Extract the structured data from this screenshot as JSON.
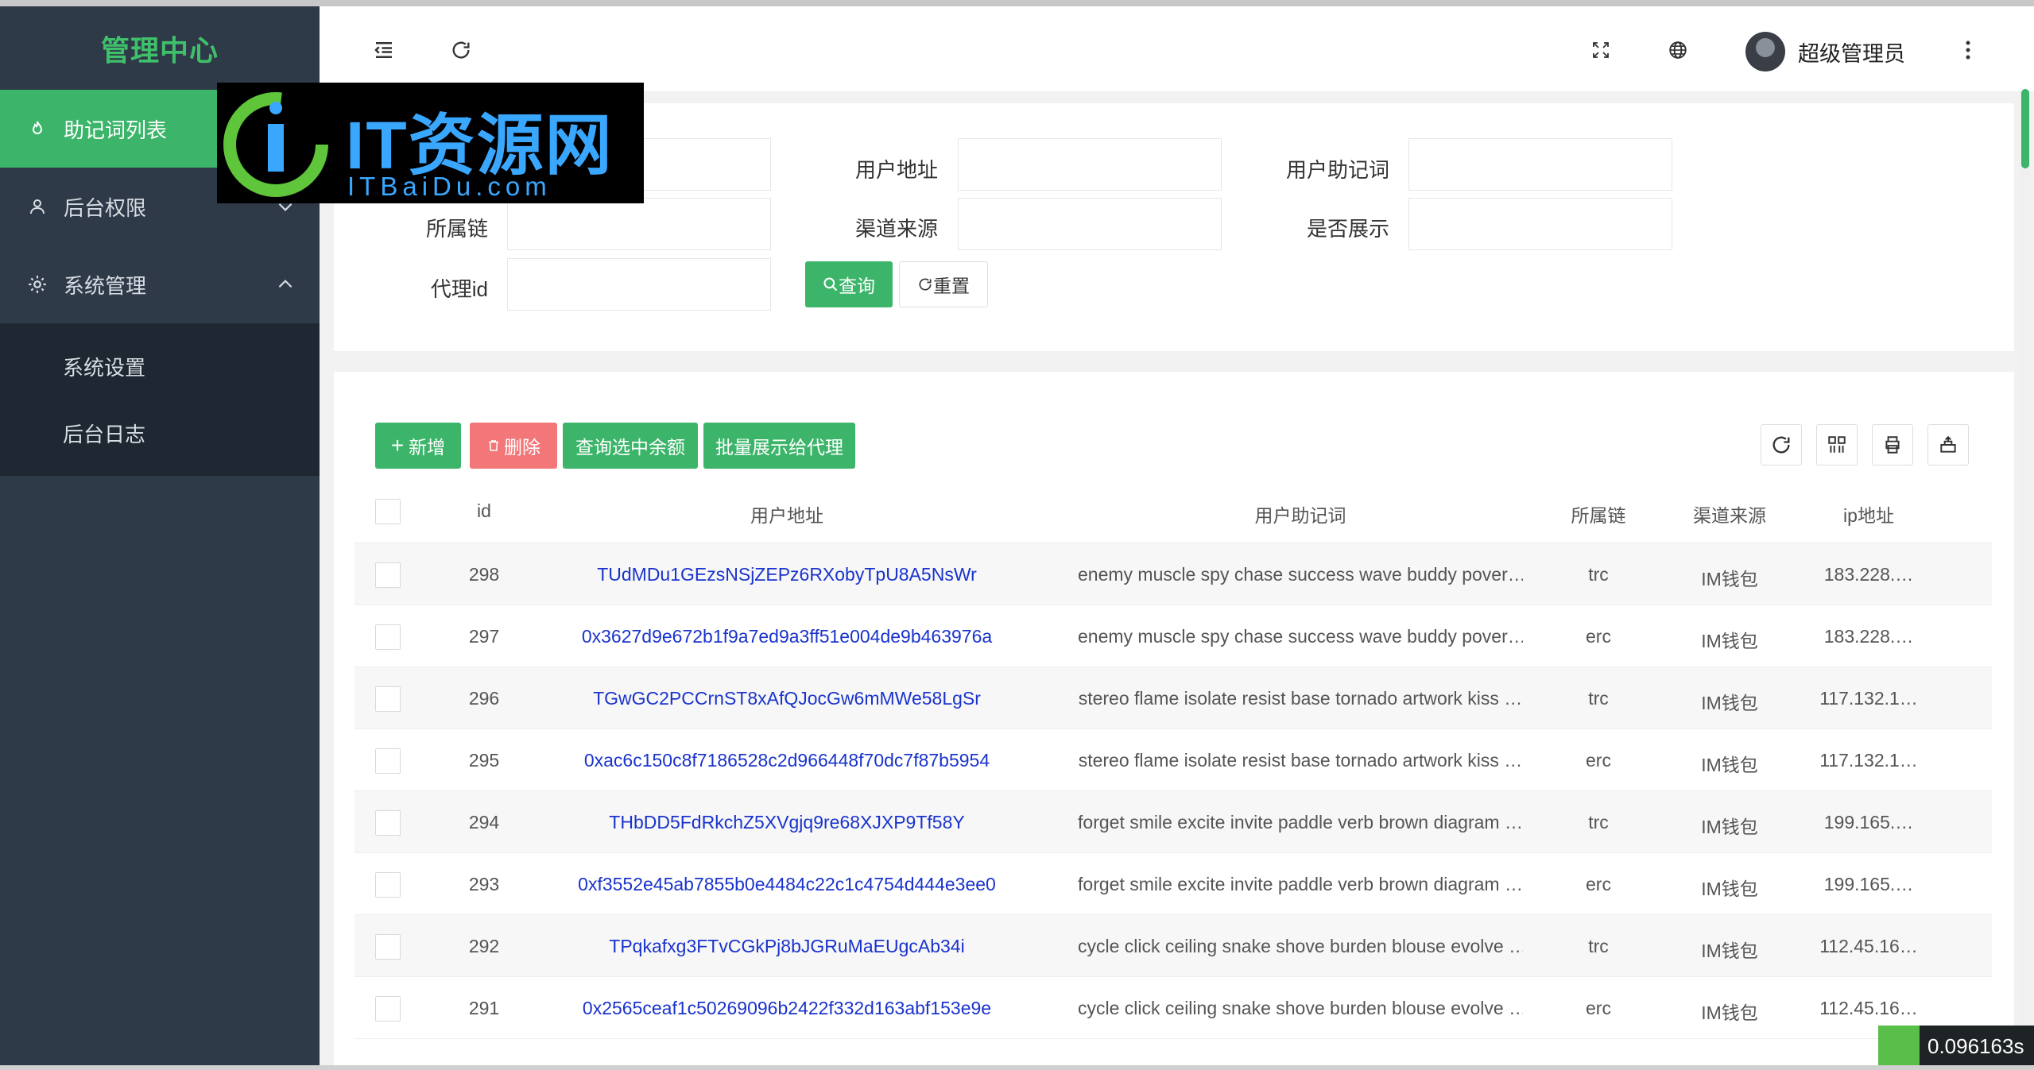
{
  "sidebar": {
    "brand": "管理中心",
    "items": [
      {
        "label": "助记词列表",
        "active": true
      },
      {
        "label": "后台权限"
      },
      {
        "label": "系统管理",
        "expanded": true
      }
    ],
    "subitems": [
      "系统设置",
      "后台日志"
    ]
  },
  "watermark": {
    "big": "IT资源网",
    "small": "ITBaiDu.com"
  },
  "header": {
    "username": "超级管理员"
  },
  "search": {
    "fields": {
      "user_address": "用户地址",
      "user_mnemonic": "用户助记词",
      "chain": "所属链",
      "channel": "渠道来源",
      "display": "是否展示",
      "agent_id": "代理id"
    },
    "query_button": "查询",
    "reset_button": "重置"
  },
  "toolbar": {
    "add": "新增",
    "delete": "删除",
    "query_balance": "查询选中余额",
    "batch_show": "批量展示给代理"
  },
  "table": {
    "columns": [
      "id",
      "用户地址",
      "用户助记词",
      "所属链",
      "渠道来源",
      "ip地址"
    ],
    "rows": [
      {
        "id": "298",
        "address": "TUdMDu1GEzsNSjZEPz6RXobyTpU8A5NsWr",
        "mnemonic": "enemy muscle spy chase success wave buddy pover…",
        "chain": "trc",
        "channel": "IM钱包",
        "ip": "183.228.…"
      },
      {
        "id": "297",
        "address": "0x3627d9e672b1f9a7ed9a3ff51e004de9b463976a",
        "mnemonic": "enemy muscle spy chase success wave buddy pover…",
        "chain": "erc",
        "channel": "IM钱包",
        "ip": "183.228.…"
      },
      {
        "id": "296",
        "address": "TGwGC2PCCrnST8xAfQJocGw6mMWe58LgSr",
        "mnemonic": "stereo flame isolate resist base tornado artwork kiss …",
        "chain": "trc",
        "channel": "IM钱包",
        "ip": "117.132.1…"
      },
      {
        "id": "295",
        "address": "0xac6c150c8f7186528c2d966448f70dc7f87b5954",
        "mnemonic": "stereo flame isolate resist base tornado artwork kiss …",
        "chain": "erc",
        "channel": "IM钱包",
        "ip": "117.132.1…"
      },
      {
        "id": "294",
        "address": "THbDD5FdRkchZ5XVgjq9re68XJXP9Tf58Y",
        "mnemonic": "forget smile excite invite paddle verb brown diagram …",
        "chain": "trc",
        "channel": "IM钱包",
        "ip": "199.165.…"
      },
      {
        "id": "293",
        "address": "0xf3552e45ab7855b0e4484c22c1c4754d444e3ee0",
        "mnemonic": "forget smile excite invite paddle verb brown diagram …",
        "chain": "erc",
        "channel": "IM钱包",
        "ip": "199.165.…"
      },
      {
        "id": "292",
        "address": "TPqkafxg3FTvCGkPj8bJGRuMaEUgcAb34i",
        "mnemonic": "cycle click ceiling snake shove burden blouse evolve …",
        "chain": "trc",
        "channel": "IM钱包",
        "ip": "112.45.16…"
      },
      {
        "id": "291",
        "address": "0x2565ceaf1c50269096b2422f332d163abf153e9e",
        "mnemonic": "cycle click ceiling snake shove burden blouse evolve …",
        "chain": "erc",
        "channel": "IM钱包",
        "ip": "112.45.16…"
      }
    ]
  },
  "timer": "0.096163s",
  "colors": {
    "accent": "#3cb56a",
    "sidebar": "#2f3a48",
    "danger": "#f37678",
    "link": "#1a33cc"
  },
  "icons": [
    "fire-icon",
    "user-icon",
    "gear-icon",
    "chevron-down-icon",
    "chevron-up-icon",
    "menu-fold-icon",
    "refresh-icon",
    "fullscreen-icon",
    "globe-icon",
    "more-icon",
    "search-icon",
    "reset-icon",
    "plus-icon",
    "trash-icon",
    "columns-icon",
    "print-icon",
    "export-icon"
  ]
}
